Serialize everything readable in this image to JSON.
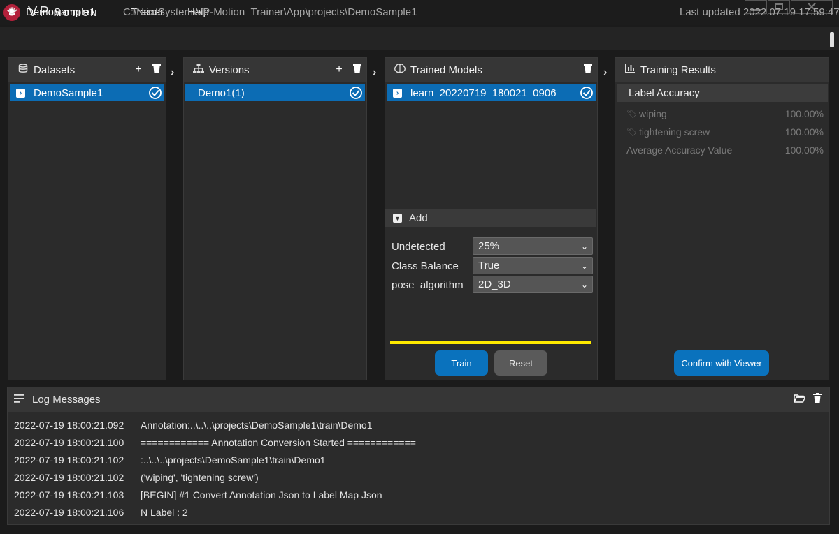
{
  "app": {
    "logo_vp": "VP",
    "logo_motion": "MOTION",
    "menu": [
      "Trainer",
      "Help"
    ],
    "window_controls": [
      "minimize-icon",
      "maximize-icon",
      "close-icon"
    ]
  },
  "path_bar": {
    "project": "DemoSample1",
    "path": "C:\\NextSystem\\VP-Motion_Trainer\\App\\projects\\DemoSample1",
    "last_updated": "Last updated 2022.07.19 17:59:47."
  },
  "datasets": {
    "title": "Datasets",
    "items": [
      {
        "label": "DemoSample1",
        "selected": true
      }
    ]
  },
  "versions": {
    "title": "Versions",
    "items": [
      {
        "label": "Demo1(1)",
        "selected": true
      }
    ]
  },
  "trained_models": {
    "title": "Trained Models",
    "items": [
      {
        "label": "learn_20220719_180021_0906",
        "selected": true
      }
    ],
    "add_label": "Add",
    "params": [
      {
        "label": "Undetected",
        "value": "25%"
      },
      {
        "label": "Class Balance",
        "value": "True"
      },
      {
        "label": "pose_algorithm",
        "value": "2D_3D"
      }
    ],
    "progress": 1.0,
    "train_label": "Train",
    "reset_label": "Reset"
  },
  "training_results": {
    "title": "Training Results",
    "subheader": "Label Accuracy",
    "rows": [
      {
        "name": "wiping",
        "value": "100.00%",
        "tag": true
      },
      {
        "name": "tightening screw",
        "value": "100.00%",
        "tag": true
      },
      {
        "name": "Average Accuracy Value",
        "value": "100.00%",
        "tag": false
      }
    ],
    "confirm_label": "Confirm with Viewer"
  },
  "log": {
    "title": "Log Messages",
    "lines": [
      {
        "time": "2022-07-19 18:00:21.092",
        "msg": "Annotation:..\\..\\..\\projects\\DemoSample1\\train\\Demo1"
      },
      {
        "time": "2022-07-19 18:00:21.100",
        "msg": "============  Annotation Conversion Started  ============"
      },
      {
        "time": "2022-07-19 18:00:21.102",
        "msg": ":..\\..\\..\\projects\\DemoSample1\\train\\Demo1"
      },
      {
        "time": "2022-07-19 18:00:21.102",
        "msg": " ('wiping', 'tightening screw')"
      },
      {
        "time": "2022-07-19 18:00:21.103",
        "msg": "[BEGIN] #1 Convert Annotation Json to Label Map Json"
      },
      {
        "time": "2022-07-19 18:00:21.106",
        "msg": "N Label : 2"
      }
    ]
  },
  "colors": {
    "accent_blue": "#0c6cb4",
    "progress_yellow": "#ffea00",
    "logo_red": "#b3213b"
  }
}
